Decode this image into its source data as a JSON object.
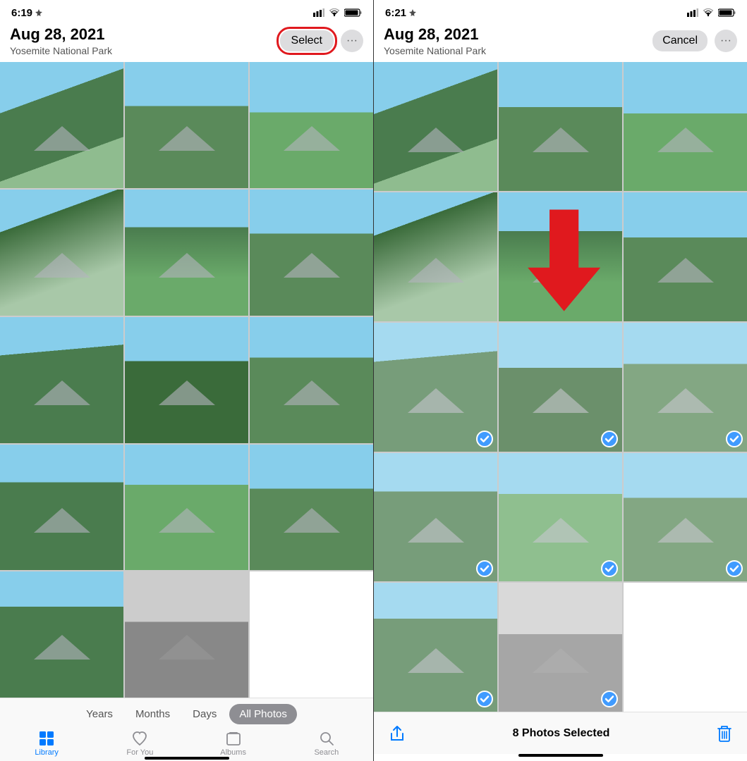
{
  "left_panel": {
    "status": {
      "time": "6:19",
      "location_icon": true
    },
    "header": {
      "date": "Aug 28, 2021",
      "subtitle": "Yosemite National Park",
      "select_label": "Select",
      "more_label": "···"
    },
    "filter_tabs": [
      "Years",
      "Months",
      "Days",
      "All Photos"
    ],
    "active_filter": "All Photos",
    "nav_tabs": [
      {
        "id": "library",
        "label": "Library",
        "active": true
      },
      {
        "id": "for-you",
        "label": "For You",
        "active": false
      },
      {
        "id": "albums",
        "label": "Albums",
        "active": false
      },
      {
        "id": "search",
        "label": "Search",
        "active": false
      }
    ],
    "photos": [
      {
        "row": 0,
        "col": 0,
        "style": "c1"
      },
      {
        "row": 0,
        "col": 1,
        "style": "c2"
      },
      {
        "row": 0,
        "col": 2,
        "style": "c3"
      },
      {
        "row": 1,
        "col": 0,
        "style": "c4"
      },
      {
        "row": 1,
        "col": 1,
        "style": "c5"
      },
      {
        "row": 1,
        "col": 2,
        "style": "c6"
      },
      {
        "row": 2,
        "col": 0,
        "style": "c7"
      },
      {
        "row": 2,
        "col": 1,
        "style": "c8"
      },
      {
        "row": 2,
        "col": 2,
        "style": "c9"
      },
      {
        "row": 3,
        "col": 0,
        "style": "c10"
      },
      {
        "row": 3,
        "col": 1,
        "style": "c11"
      },
      {
        "row": 3,
        "col": 2,
        "style": "c12"
      },
      {
        "row": 4,
        "col": 0,
        "style": "c13"
      },
      {
        "row": 4,
        "col": 1,
        "style": "c14 bw"
      },
      {
        "row": 4,
        "col": 2,
        "style": "c15 empty"
      }
    ]
  },
  "right_panel": {
    "status": {
      "time": "6:21",
      "location_icon": true
    },
    "header": {
      "date": "Aug 28, 2021",
      "subtitle": "Yosemite National Park",
      "cancel_label": "Cancel",
      "more_label": "···"
    },
    "selection_bar": {
      "count_label": "8 Photos Selected"
    },
    "photos": [
      {
        "row": 0,
        "col": 0,
        "style": "c1",
        "selected": false
      },
      {
        "row": 0,
        "col": 1,
        "style": "c2",
        "selected": false
      },
      {
        "row": 0,
        "col": 2,
        "style": "c3",
        "selected": false
      },
      {
        "row": 1,
        "col": 0,
        "style": "c4",
        "selected": false
      },
      {
        "row": 1,
        "col": 1,
        "style": "c5",
        "selected": false
      },
      {
        "row": 1,
        "col": 2,
        "style": "c6",
        "selected": false
      },
      {
        "row": 2,
        "col": 0,
        "style": "c7",
        "selected": true
      },
      {
        "row": 2,
        "col": 1,
        "style": "c8",
        "selected": true
      },
      {
        "row": 2,
        "col": 2,
        "style": "c9",
        "selected": true
      },
      {
        "row": 3,
        "col": 0,
        "style": "c10",
        "selected": true
      },
      {
        "row": 3,
        "col": 1,
        "style": "c11",
        "selected": true
      },
      {
        "row": 3,
        "col": 2,
        "style": "c12",
        "selected": true
      },
      {
        "row": 4,
        "col": 0,
        "style": "c13",
        "selected": true
      },
      {
        "row": 4,
        "col": 1,
        "style": "c14 bw",
        "selected": true
      },
      {
        "row": 4,
        "col": 2,
        "style": "c15 empty",
        "selected": false
      }
    ]
  }
}
